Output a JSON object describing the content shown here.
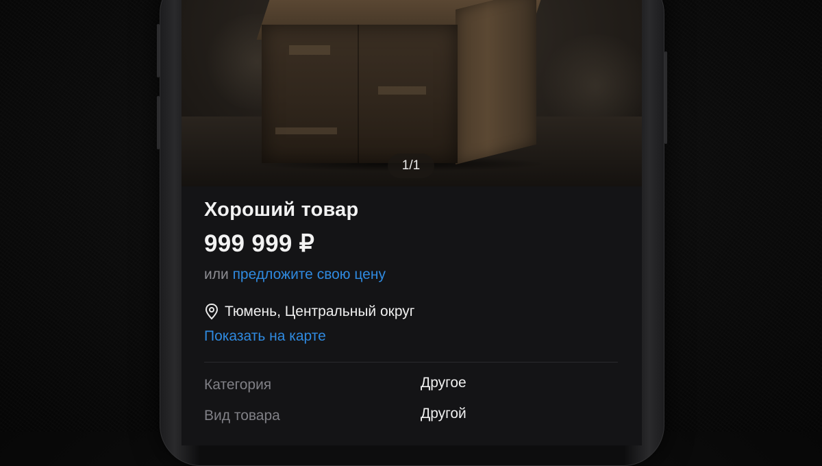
{
  "listing": {
    "photo_counter": "1/1",
    "title": "Хороший товар",
    "price": "999 999 ₽",
    "offer_prefix": "или",
    "offer_link": "предложите свою цену",
    "location_icon": "map-pin-icon",
    "location": "Тюмень, Центральный округ",
    "map_link": "Показать на карте",
    "params": [
      {
        "label": "Категория",
        "value": "Другое"
      },
      {
        "label": "Вид товара",
        "value": "Другой"
      }
    ]
  },
  "colors": {
    "link": "#2f8ae0",
    "screen_background": "#141416",
    "primary_text": "#f2f2f2",
    "secondary_text": "#8e8e93"
  }
}
